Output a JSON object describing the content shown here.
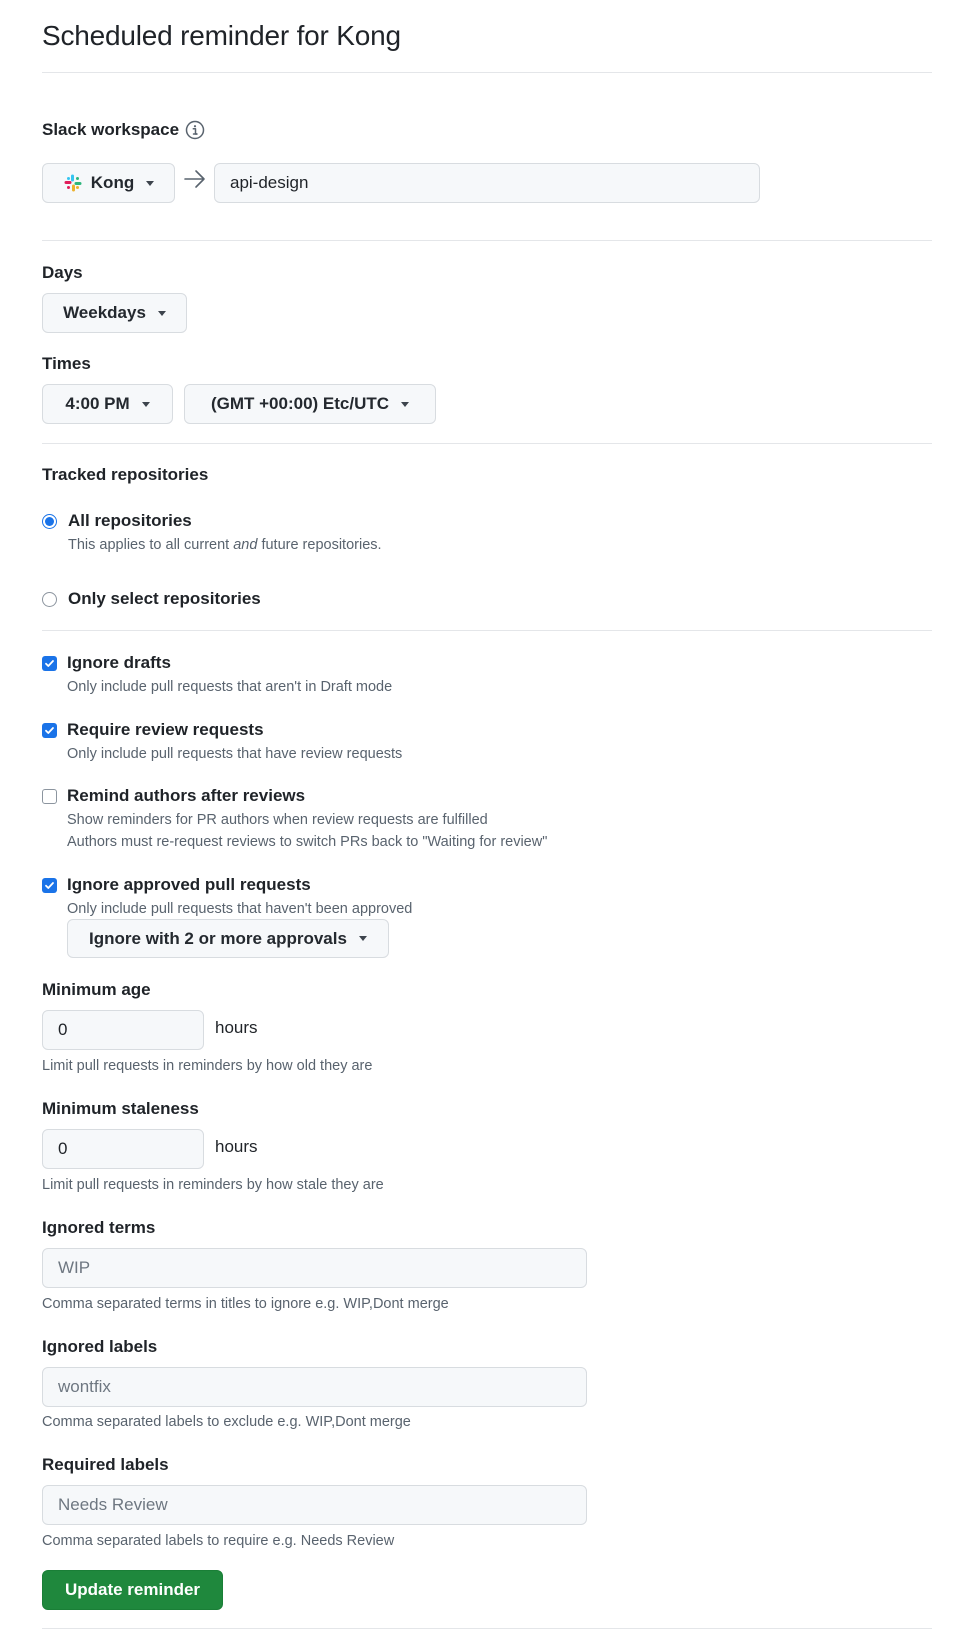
{
  "page": {
    "title": "Scheduled reminder for Kong"
  },
  "slack": {
    "label": "Slack workspace",
    "info_icon": "info-icon",
    "workspace_button": "Kong",
    "workspace_icon": "slack-logo-icon",
    "arrow_icon": "arrow-right-icon",
    "channel_value": "api-design"
  },
  "days": {
    "label": "Days",
    "selected": "Weekdays"
  },
  "times": {
    "label": "Times",
    "time_selected": "4:00 PM",
    "timezone_selected": "(GMT +00:00) Etc/UTC"
  },
  "repositories": {
    "label": "Tracked repositories",
    "options": [
      {
        "label": "All repositories",
        "selected": true,
        "desc_before": "This applies to all current ",
        "desc_em": "and",
        "desc_after": " future repositories."
      },
      {
        "label": "Only select repositories",
        "selected": false
      }
    ]
  },
  "options": [
    {
      "label": "Ignore drafts",
      "checked": true,
      "desc": [
        "Only include pull requests that aren't in Draft mode"
      ]
    },
    {
      "label": "Require review requests",
      "checked": true,
      "desc": [
        "Only include pull requests that have review requests"
      ]
    },
    {
      "label": "Remind authors after reviews",
      "checked": false,
      "desc": [
        "Show reminders for PR authors when review requests are fulfilled",
        "Authors must re-request reviews to switch PRs back to \"Waiting for review\""
      ]
    },
    {
      "label": "Ignore approved pull requests",
      "checked": true,
      "desc": [
        "Only include pull requests that haven't been approved"
      ]
    }
  ],
  "approvals_dropdown": "Ignore with 2 or more approvals",
  "minimum_age": {
    "label": "Minimum age",
    "value": "0",
    "units": "hours",
    "help": "Limit pull requests in reminders by how old they are"
  },
  "minimum_staleness": {
    "label": "Minimum staleness",
    "value": "0",
    "units": "hours",
    "help": "Limit pull requests in reminders by how stale they are"
  },
  "ignored_terms": {
    "label": "Ignored terms",
    "placeholder": "WIP",
    "help": "Comma separated terms in titles to ignore e.g. WIP,Dont merge"
  },
  "ignored_labels": {
    "label": "Ignored labels",
    "placeholder": "wontfix",
    "help": "Comma separated labels to exclude e.g. WIP,Dont merge"
  },
  "required_labels": {
    "label": "Required labels",
    "placeholder": "Needs Review",
    "help": "Comma separated labels to require e.g. Needs Review"
  },
  "submit": {
    "label": "Update reminder"
  },
  "colors": {
    "accent_blue": "#1a73e8",
    "primary_green": "#1f883d",
    "slack_red": "#e01e5a",
    "slack_blue": "#36c5f0",
    "slack_green": "#2eb67d",
    "slack_yellow": "#ecb22e"
  }
}
